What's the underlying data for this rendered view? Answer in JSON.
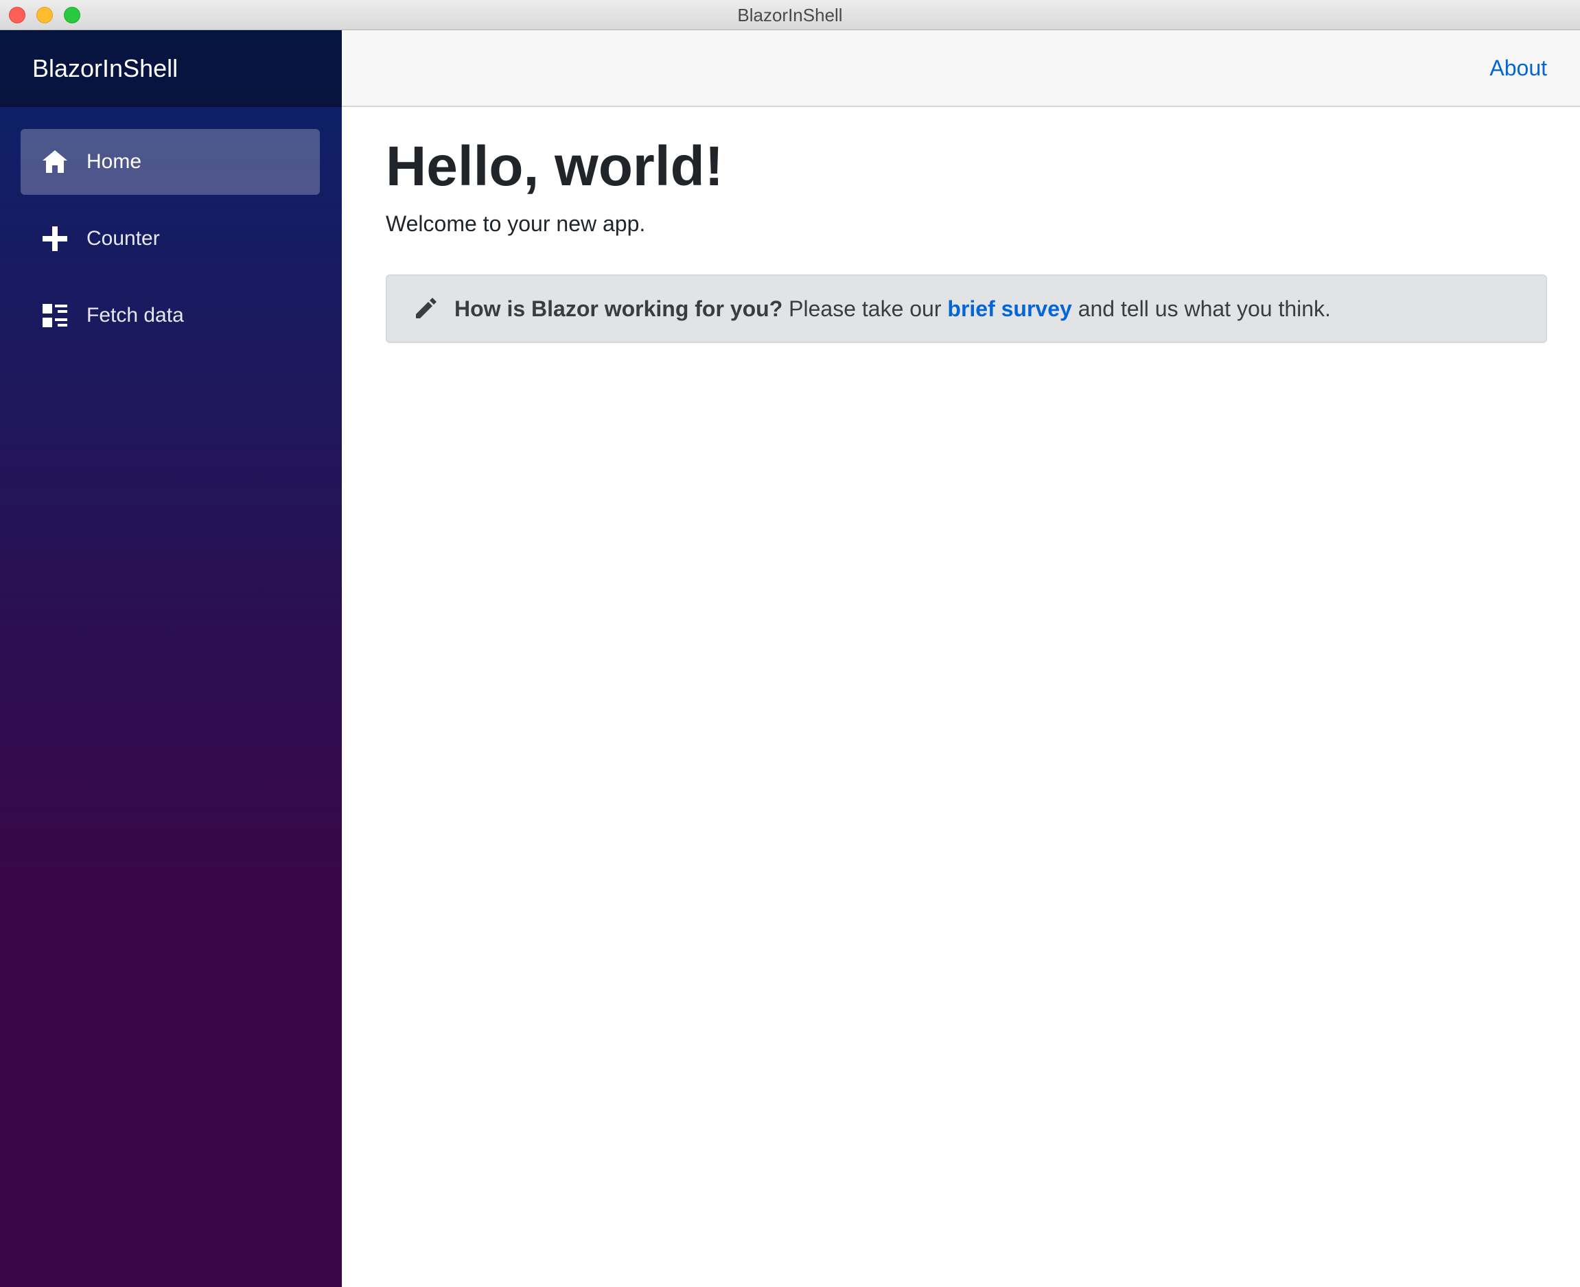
{
  "window": {
    "title": "BlazorInShell"
  },
  "sidebar": {
    "brand": "BlazorInShell",
    "items": [
      {
        "label": "Home",
        "icon": "home-icon",
        "active": true
      },
      {
        "label": "Counter",
        "icon": "plus-icon",
        "active": false
      },
      {
        "label": "Fetch data",
        "icon": "list-rich-icon",
        "active": false
      }
    ]
  },
  "top_row": {
    "about_label": "About"
  },
  "main": {
    "heading": "Hello, world!",
    "welcome": "Welcome to your new app.",
    "survey": {
      "icon": "pencil-icon",
      "question": "How is Blazor working for you?",
      "before_link": "Please take our",
      "link_text": "brief survey",
      "after_link": "and tell us what you think."
    }
  },
  "colors": {
    "sidebar_top": "#0b236b",
    "sidebar_bottom": "#3a0647",
    "link": "#0366d6",
    "alert_bg": "#e2e3e5"
  }
}
